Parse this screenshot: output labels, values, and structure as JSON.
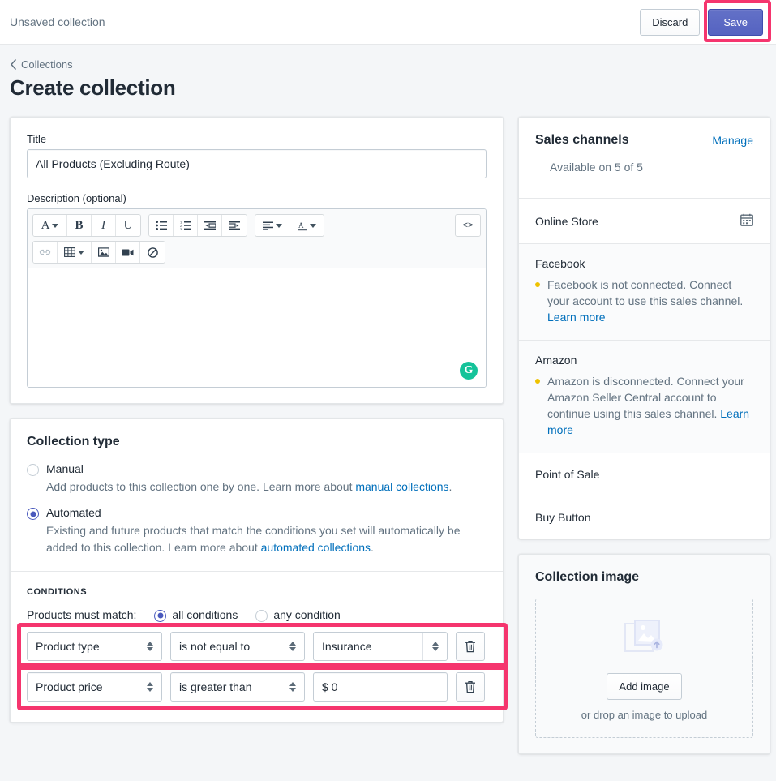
{
  "savebar": {
    "title": "Unsaved collection",
    "discard_label": "Discard",
    "save_label": "Save",
    "highlight_color": "#f5356e",
    "save_button_color": "#5563c1"
  },
  "header": {
    "breadcrumb": "Collections",
    "page_title": "Create collection"
  },
  "form": {
    "title_label": "Title",
    "title_value": "All Products (Excluding Route)",
    "description_label": "Description (optional)",
    "description_value": "",
    "grammarly_badge": "G"
  },
  "editor_toolbar": {
    "row1": [
      {
        "icon": "font-family-icon",
        "glyph": "A",
        "caret": true
      },
      {
        "icon": "bold-icon",
        "glyph": "B",
        "caret": false
      },
      {
        "icon": "italic-icon",
        "glyph": "I",
        "caret": false
      },
      {
        "icon": "underline-icon",
        "glyph": "U",
        "caret": false
      },
      {
        "icon": "bulleted-list-icon",
        "glyph": "",
        "caret": false
      },
      {
        "icon": "numbered-list-icon",
        "glyph": "",
        "caret": false
      },
      {
        "icon": "outdent-icon",
        "glyph": "",
        "caret": false
      },
      {
        "icon": "indent-icon",
        "glyph": "",
        "caret": false
      },
      {
        "icon": "align-left-icon",
        "glyph": "",
        "caret": true
      },
      {
        "icon": "text-color-icon",
        "glyph": "A",
        "caret": true
      }
    ],
    "code_view_label": "<>",
    "row2": [
      {
        "icon": "link-icon",
        "disabled": true
      },
      {
        "icon": "table-icon",
        "disabled": false,
        "caret": true
      },
      {
        "icon": "image-icon",
        "disabled": false
      },
      {
        "icon": "video-icon",
        "disabled": false
      },
      {
        "icon": "clear-formatting-icon",
        "disabled": false
      }
    ]
  },
  "collection_type": {
    "section_title": "Collection type",
    "options": [
      {
        "label": "Manual",
        "selected": false,
        "help_prefix": "Add products to this collection one by one. Learn more about ",
        "help_link": "manual collections",
        "help_suffix": "."
      },
      {
        "label": "Automated",
        "selected": true,
        "help_prefix": "Existing and future products that match the conditions you set will automatically be added to this collection. Learn more about ",
        "help_link": "automated collections",
        "help_suffix": "."
      }
    ]
  },
  "conditions": {
    "heading": "CONDITIONS",
    "match_label": "Products must match:",
    "match_options": [
      {
        "label": "all conditions",
        "selected": true
      },
      {
        "label": "any condition",
        "selected": false
      }
    ],
    "rows": [
      {
        "field": "Product type",
        "operator": "is not equal to",
        "value": "Insurance",
        "value_type": "combo",
        "highlighted": true,
        "delete_label": "delete-condition"
      },
      {
        "field": "Product price",
        "operator": "is greater than",
        "value": "$ 0",
        "value_type": "input",
        "highlighted": true,
        "delete_label": "delete-condition"
      }
    ]
  },
  "sales_channels": {
    "title": "Sales channels",
    "manage_label": "Manage",
    "availability": "Available on 5 of 5",
    "channels": [
      {
        "name": "Online Store",
        "icon": "calendar-icon",
        "alert": null,
        "link": null
      },
      {
        "name": "Facebook",
        "icon": null,
        "alert": "Facebook is not connected. Connect your account to use this sales channel. ",
        "link": "Learn more"
      },
      {
        "name": "Amazon",
        "icon": null,
        "alert": "Amazon is disconnected. Connect your Amazon Seller Central account to continue using this sales channel. ",
        "link": "Learn more"
      },
      {
        "name": "Point of Sale",
        "icon": null,
        "alert": null,
        "link": null
      },
      {
        "name": "Buy Button",
        "icon": null,
        "alert": null,
        "link": null
      }
    ]
  },
  "collection_image": {
    "title": "Collection image",
    "add_label": "Add image",
    "drop_hint": "or drop an image to upload"
  }
}
